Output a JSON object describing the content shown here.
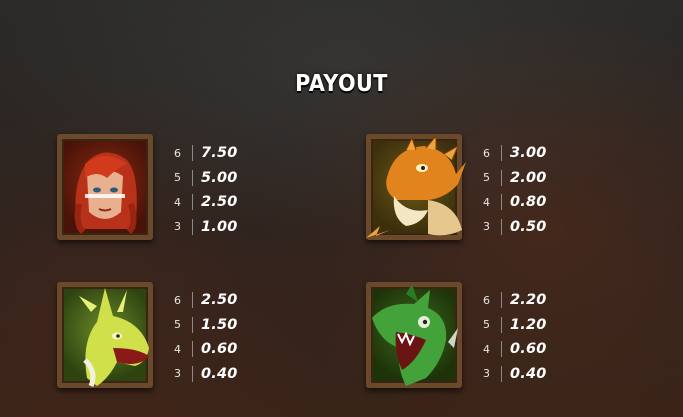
{
  "title": "PAYOUT",
  "symbols": [
    {
      "name": "red-haired-warrior",
      "payouts": [
        {
          "count": "6",
          "value": "7.50"
        },
        {
          "count": "5",
          "value": "5.00"
        },
        {
          "count": "4",
          "value": "2.50"
        },
        {
          "count": "3",
          "value": "1.00"
        }
      ]
    },
    {
      "name": "orange-dragon",
      "payouts": [
        {
          "count": "6",
          "value": "3.00"
        },
        {
          "count": "5",
          "value": "2.00"
        },
        {
          "count": "4",
          "value": "0.80"
        },
        {
          "count": "3",
          "value": "0.50"
        }
      ]
    },
    {
      "name": "yellow-green-dragon",
      "payouts": [
        {
          "count": "6",
          "value": "2.50"
        },
        {
          "count": "5",
          "value": "1.50"
        },
        {
          "count": "4",
          "value": "0.60"
        },
        {
          "count": "3",
          "value": "0.40"
        }
      ]
    },
    {
      "name": "green-dragon",
      "payouts": [
        {
          "count": "6",
          "value": "2.20"
        },
        {
          "count": "5",
          "value": "1.20"
        },
        {
          "count": "4",
          "value": "0.60"
        },
        {
          "count": "3",
          "value": "0.40"
        }
      ]
    }
  ]
}
